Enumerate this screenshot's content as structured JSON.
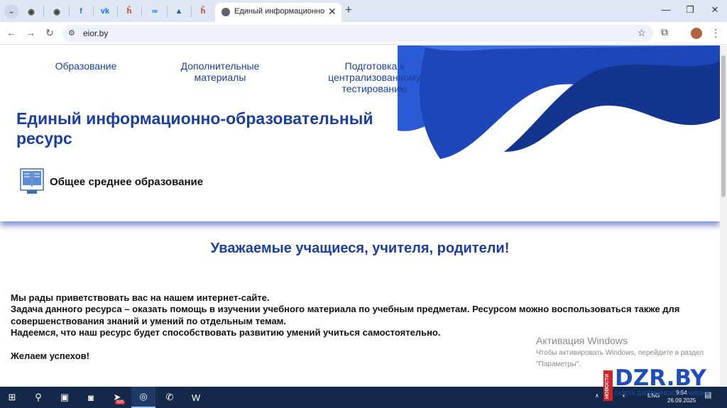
{
  "browser": {
    "tab_title": "Единый информационно-обр",
    "url": "eior.by",
    "pinned_tabs": [
      {
        "icon": "globe-icon",
        "glyph": "◉",
        "color": "#444444"
      },
      {
        "icon": "globe-icon",
        "glyph": "◉",
        "color": "#444444"
      },
      {
        "icon": "facebook-icon",
        "glyph": "f",
        "color": "#1877f2"
      },
      {
        "icon": "vk-icon",
        "glyph": "vk",
        "color": "#0077ff"
      },
      {
        "icon": "h-icon",
        "glyph": "ĥ",
        "color": "#c0392b"
      },
      {
        "icon": "infinity-icon",
        "glyph": "∞",
        "color": "#1a73e8"
      },
      {
        "icon": "mountain-icon",
        "glyph": "▲",
        "color": "#2b5ea7"
      },
      {
        "icon": "h-icon",
        "glyph": "ĥ",
        "color": "#c0392b"
      }
    ]
  },
  "site": {
    "nav": [
      {
        "label": "Образование"
      },
      {
        "label": "Дополнительные\nматериалы"
      },
      {
        "label": "Подготовка к\nцентрализованному\nтестированию"
      }
    ],
    "title": "Единый информационно-образовательный ресурс",
    "section_label": "Общее среднее образование",
    "greeting": "Уважаемые учащиеся, учителя, родители!",
    "body_lines": [
      "Мы рады приветствовать вас на нашем интернет-сайте.",
      "Задача данного ресурса – оказать помощь в изучении учебного материала по учебным предметам. Ресурсом можно воспользоваться также для совершенствования знаний и умений по отдельным темам.",
      "Надеемся, что наш ресурс будет способствовать развитию умений учиться самостоятельно."
    ],
    "wish": "Желаем успехов!",
    "brand_color": "#1b3fa0"
  },
  "windows_activation": {
    "title": "Активация Windows",
    "text": "Чтобы активировать Windows, перейдите в раздел \"Параметры\"."
  },
  "taskbar": {
    "items": [
      {
        "icon": "windows-start-icon",
        "glyph": "⊞"
      },
      {
        "icon": "search-icon",
        "glyph": "⚲"
      },
      {
        "icon": "task-view-icon",
        "glyph": "▣"
      },
      {
        "icon": "camera-icon",
        "glyph": "◙"
      },
      {
        "icon": "telegram-icon",
        "glyph": "➤"
      },
      {
        "icon": "chrome-icon",
        "glyph": "◎"
      },
      {
        "icon": "viber-icon",
        "glyph": "✆"
      },
      {
        "icon": "word-icon",
        "glyph": "W"
      }
    ],
    "telegram_badge": "325",
    "language": "ENG",
    "time": "9:54",
    "date": "26.09.2025"
  },
  "watermark": {
    "logo": "DZR.BY",
    "tag": "НОВОСТИ",
    "sub": "ГАЗЕТА ДЗЕРЖИНСКОГО РАЙОНА"
  }
}
